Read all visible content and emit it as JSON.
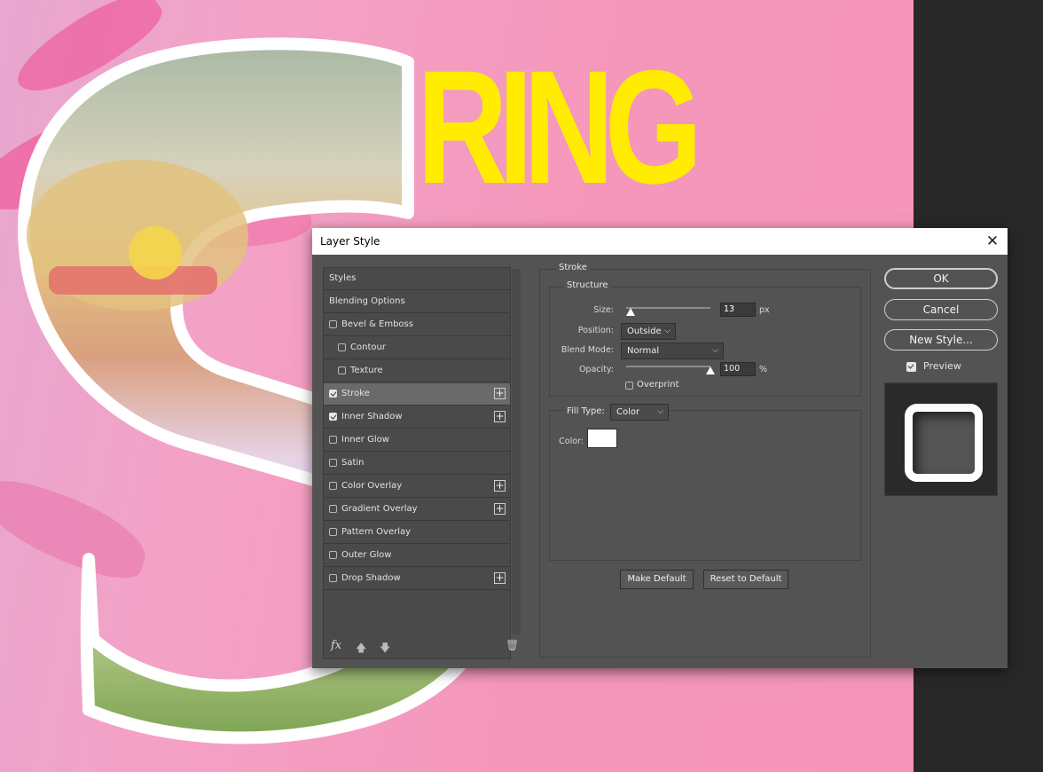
{
  "artwork": {
    "headline": "RING",
    "headline_color": "#ffec00",
    "background_color": "#f596b9"
  },
  "dialog": {
    "title": "Layer Style",
    "close_glyph": "✕",
    "styles_list": [
      {
        "label": "Styles",
        "checkbox": false,
        "checked": false,
        "indent": false,
        "plus": false,
        "selected": false
      },
      {
        "label": "Blending Options",
        "checkbox": false,
        "checked": false,
        "indent": false,
        "plus": false,
        "selected": false
      },
      {
        "label": "Bevel & Emboss",
        "checkbox": true,
        "checked": false,
        "indent": false,
        "plus": false,
        "selected": false
      },
      {
        "label": "Contour",
        "checkbox": true,
        "checked": false,
        "indent": true,
        "plus": false,
        "selected": false
      },
      {
        "label": "Texture",
        "checkbox": true,
        "checked": false,
        "indent": true,
        "plus": false,
        "selected": false
      },
      {
        "label": "Stroke",
        "checkbox": true,
        "checked": true,
        "indent": false,
        "plus": true,
        "selected": true
      },
      {
        "label": "Inner Shadow",
        "checkbox": true,
        "checked": true,
        "indent": false,
        "plus": true,
        "selected": false
      },
      {
        "label": "Inner Glow",
        "checkbox": true,
        "checked": false,
        "indent": false,
        "plus": false,
        "selected": false
      },
      {
        "label": "Satin",
        "checkbox": true,
        "checked": false,
        "indent": false,
        "plus": false,
        "selected": false
      },
      {
        "label": "Color Overlay",
        "checkbox": true,
        "checked": false,
        "indent": false,
        "plus": true,
        "selected": false
      },
      {
        "label": "Gradient Overlay",
        "checkbox": true,
        "checked": false,
        "indent": false,
        "plus": true,
        "selected": false
      },
      {
        "label": "Pattern Overlay",
        "checkbox": true,
        "checked": false,
        "indent": false,
        "plus": false,
        "selected": false
      },
      {
        "label": "Outer Glow",
        "checkbox": true,
        "checked": false,
        "indent": false,
        "plus": false,
        "selected": false
      },
      {
        "label": "Drop Shadow",
        "checkbox": true,
        "checked": false,
        "indent": false,
        "plus": true,
        "selected": false
      }
    ],
    "footer": {
      "fx": "fx",
      "up_icon": "arrow-up-icon",
      "down_icon": "arrow-down-icon",
      "trash_icon": "trash-icon"
    },
    "stroke": {
      "section_title": "Stroke",
      "structure_title": "Structure",
      "size_label": "Size:",
      "size_value": "13",
      "size_unit": "px",
      "size_fraction": 0.05,
      "position_label": "Position:",
      "position_value": "Outside",
      "blend_mode_label": "Blend Mode:",
      "blend_mode_value": "Normal",
      "opacity_label": "Opacity:",
      "opacity_value": "100",
      "opacity_unit": "%",
      "opacity_fraction": 1.0,
      "overprint_label": "Overprint",
      "fill_type_label": "Fill Type:",
      "fill_type_value": "Color",
      "color_label": "Color:",
      "color_value": "#ffffff",
      "make_default": "Make Default",
      "reset_default": "Reset to Default"
    },
    "buttons": {
      "ok": "OK",
      "cancel": "Cancel",
      "new_style": "New Style...",
      "preview_label": "Preview",
      "preview_checked": true
    }
  }
}
